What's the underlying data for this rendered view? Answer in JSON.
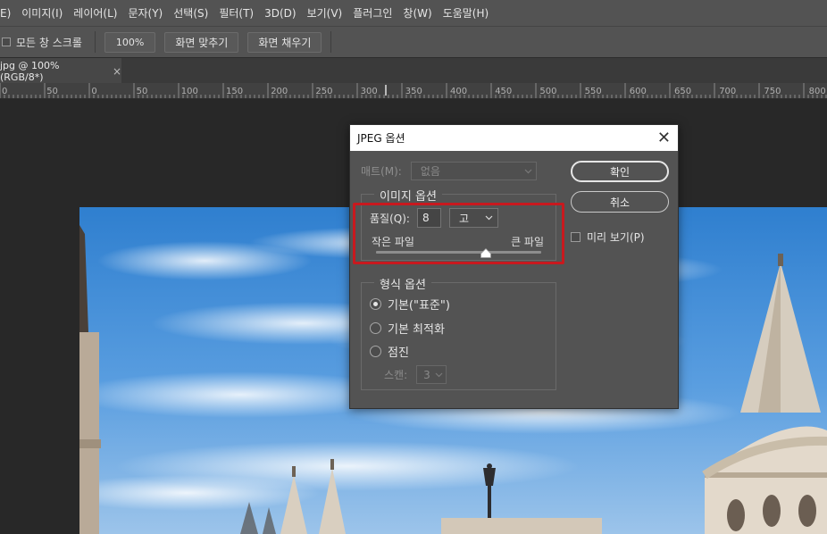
{
  "menubar": {
    "items": [
      "E)",
      "이미지(I)",
      "레이어(L)",
      "문자(Y)",
      "선택(S)",
      "필터(T)",
      "3D(D)",
      "보기(V)",
      "플러그인",
      "창(W)",
      "도움말(H)"
    ]
  },
  "options_bar": {
    "scroll_all_label": "모든 창 스크롤",
    "zoom_value": "100%",
    "fit_screen_label": "화면 맞추기",
    "fill_screen_label": "화면 채우기"
  },
  "document_tab": {
    "title": "jpg @ 100% (RGB/8*)",
    "close_glyph": "×"
  },
  "ruler": {
    "labels": [
      "0",
      "50",
      "0",
      "50",
      "100",
      "150",
      "200",
      "250",
      "300",
      "350",
      "400",
      "450",
      "500",
      "550",
      "600",
      "650",
      "700",
      "750",
      "800"
    ]
  },
  "dialog": {
    "title": "JPEG 옵션",
    "close_glyph": "✕",
    "matte_label": "매트(M):",
    "matte_value": "없음",
    "image_options_title": "이미지 옵션",
    "quality_label": "품질(Q):",
    "quality_value": "8",
    "quality_level": "고",
    "small_file_label": "작은 파일",
    "large_file_label": "큰 파일",
    "quality_slider_fraction": 0.667,
    "format_options_title": "형식 옵션",
    "format_options": [
      {
        "label": "기본(\"표준\")",
        "selected": true
      },
      {
        "label": "기본 최적화",
        "selected": false
      },
      {
        "label": "점진",
        "selected": false
      }
    ],
    "scan_label": "스캔:",
    "scan_value": "3",
    "ok_label": "확인",
    "cancel_label": "취소",
    "preview_label": "미리 보기(P)",
    "highlight_color": "#c8191e"
  }
}
